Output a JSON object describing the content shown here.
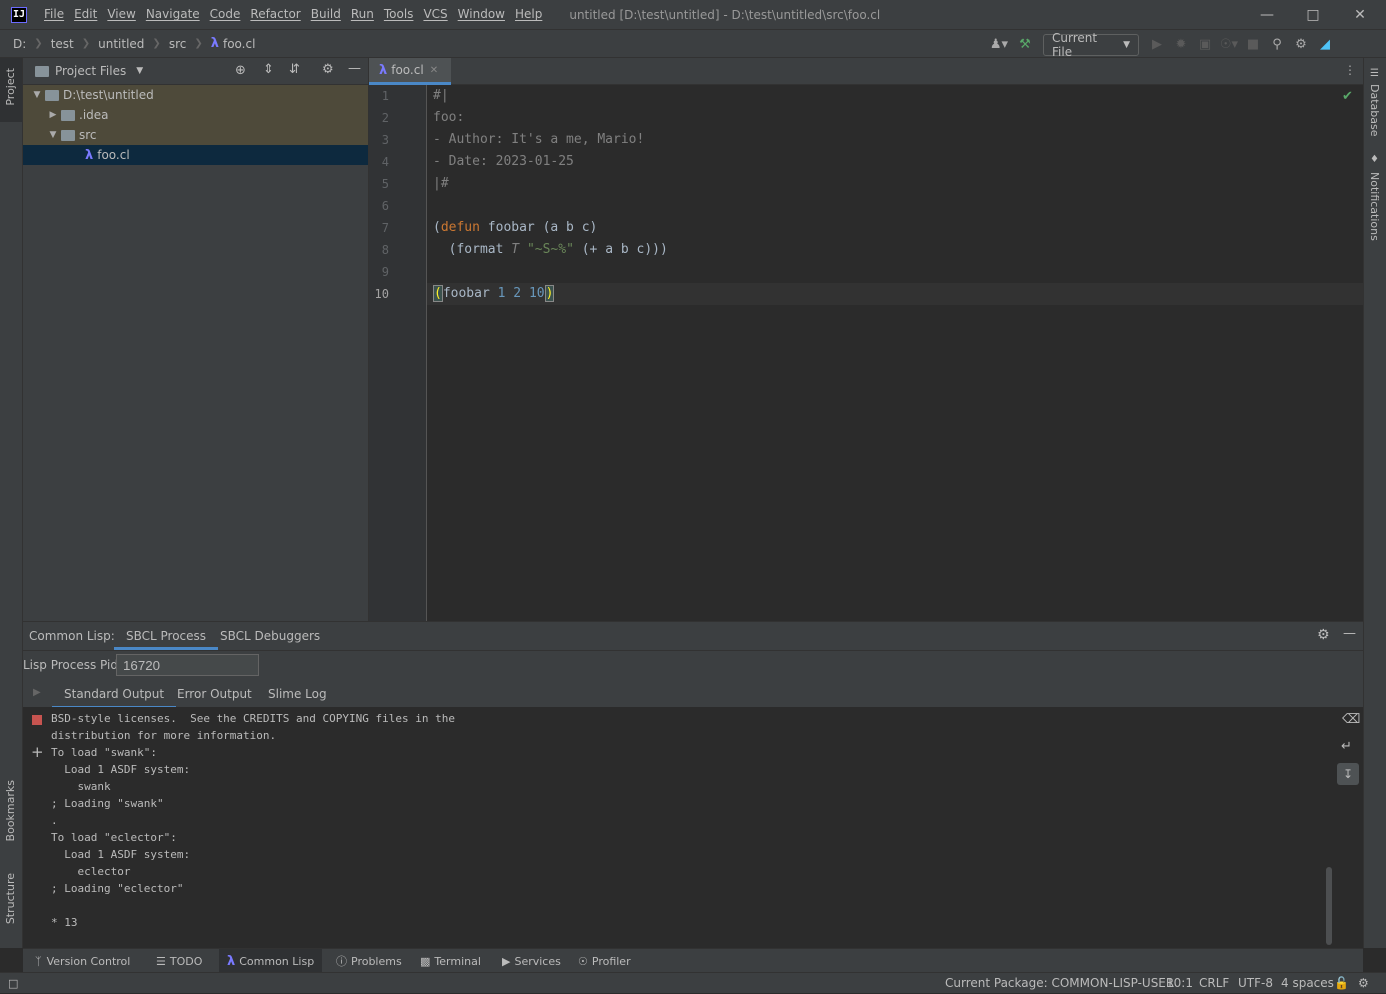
{
  "menu": [
    "File",
    "Edit",
    "View",
    "Navigate",
    "Code",
    "Refactor",
    "Build",
    "Run",
    "Tools",
    "VCS",
    "Window",
    "Help"
  ],
  "window_title": "untitled [D:\\test\\untitled] - D:\\test\\untitled\\src\\foo.cl",
  "breadcrumbs": [
    "D:",
    "test",
    "untitled",
    "src",
    "foo.cl"
  ],
  "run_config": "Current File",
  "project_panel": {
    "title": "Project Files",
    "tree": [
      {
        "label": "D:\\test\\untitled",
        "expanded": true
      },
      {
        "label": ".idea",
        "expanded": false
      },
      {
        "label": "src",
        "expanded": true
      },
      {
        "label": "foo.cl",
        "selected": true
      }
    ]
  },
  "left_strip": {
    "project": "Project",
    "bookmarks": "Bookmarks",
    "structure": "Structure"
  },
  "right_strip": {
    "database": "Database",
    "notifications": "Notifications"
  },
  "editor_tab": "foo.cl",
  "line_numbers": [
    "1",
    "2",
    "3",
    "4",
    "5",
    "6",
    "7",
    "8",
    "9",
    "10"
  ],
  "code": {
    "l1": "#|",
    "l2": "foo:",
    "l3": "- Author: It's a me, Mario!",
    "l4": "- Date: 2023-01-25",
    "l5": "|#",
    "l7_open": "(",
    "l7_kw": "defun",
    "l7_rest": " foobar (a b c)",
    "l8_a": "  (format ",
    "l8_t": "T",
    "l8_sp": " ",
    "l8_str": "\"~S~%\"",
    "l8_b": " (+ a b c)))",
    "l10_open": "(",
    "l10_fn": "foobar ",
    "l10_n1": "1",
    "l10_sp1": " ",
    "l10_n2": "2",
    "l10_sp2": " ",
    "l10_n3": "10",
    "l10_close": ")"
  },
  "toolwindow": {
    "label": "Common Lisp:",
    "tabs": [
      "SBCL Process",
      "SBCL Debuggers"
    ],
    "pid_label": "Lisp Process Pid:",
    "pid_value": "16720",
    "subtabs": [
      "Standard Output",
      "Error Output",
      "Slime Log"
    ]
  },
  "console_lines": [
    "BSD-style licenses.  See the CREDITS and COPYING files in the",
    "distribution for more information.",
    "To load \"swank\":",
    "  Load 1 ASDF system:",
    "    swank",
    "; Loading \"swank\"",
    ".",
    "To load \"eclector\":",
    "  Load 1 ASDF system:",
    "    eclector",
    "; Loading \"eclector\"",
    "",
    "* 13"
  ],
  "bottom_tools": [
    "Version Control",
    "TODO",
    "Common Lisp",
    "Problems",
    "Terminal",
    "Services",
    "Profiler"
  ],
  "status": {
    "package": "Current Package: COMMON-LISP-USER",
    "position": "10:1",
    "line_sep": "CRLF",
    "encoding": "UTF-8",
    "indent": "4 spaces"
  },
  "colors": {
    "accent": "#4a88c7",
    "keyword": "#cc7832",
    "number": "#6897bb",
    "string": "#6a8759",
    "comment": "#808080"
  }
}
